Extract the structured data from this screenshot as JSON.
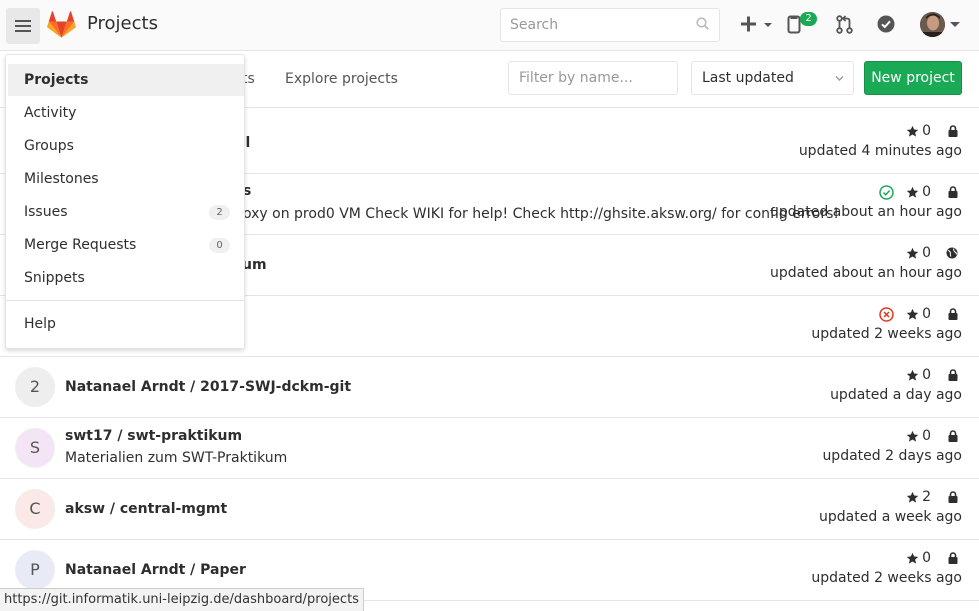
{
  "header": {
    "title": "Projects",
    "search_placeholder": "Search",
    "todo_count": "2",
    "colors": {
      "accent_green": "#1aaa55",
      "logo_orange": "#e24329"
    }
  },
  "subnav": {
    "tab_partial": "ts",
    "tab_explore": "Explore projects",
    "filter_placeholder": "Filter by name...",
    "sort_label": "Last updated",
    "new_project_label": "New project"
  },
  "rows": [
    {
      "avatar": "",
      "name": "al",
      "desc": "",
      "stars": "0",
      "updated": "updated 4 minutes ago",
      "visibility": "lock-icon",
      "status": ""
    },
    {
      "avatar": "",
      "name": "s",
      "desc": "oxy on prod0 VM Check WIKI for help! Check http://ghsite.aksw.org/ for config errors!",
      "stars": "0",
      "updated": "updated about an hour ago",
      "visibility": "lock-icon",
      "status": "success"
    },
    {
      "avatar": "",
      "name": "um",
      "desc": "",
      "stars": "0",
      "updated": "updated about an hour ago",
      "visibility": "globe-icon",
      "status": ""
    },
    {
      "avatar": "",
      "name": "",
      "desc": "",
      "stars": "0",
      "updated": "updated 2 weeks ago",
      "visibility": "lock-icon",
      "status": "failed"
    },
    {
      "avatar": "2",
      "name": "Natanael Arndt / 2017-SWJ-dckm-git",
      "desc": "",
      "stars": "0",
      "updated": "updated a day ago",
      "visibility": "lock-icon",
      "status": ""
    },
    {
      "avatar": "S",
      "name": "swt17 / swt-praktikum",
      "desc": "Materialien zum SWT-Praktikum",
      "stars": "0",
      "updated": "updated 2 days ago",
      "visibility": "lock-icon",
      "status": ""
    },
    {
      "avatar": "C",
      "name": "aksw / central-mgmt",
      "desc": "",
      "stars": "2",
      "updated": "updated a week ago",
      "visibility": "lock-icon",
      "status": ""
    },
    {
      "avatar": "P",
      "name": "Natanael Arndt / Paper",
      "desc": "",
      "stars": "0",
      "updated": "updated 2 weeks ago",
      "visibility": "lock-icon",
      "status": ""
    }
  ],
  "dropdown": {
    "items": [
      {
        "label": "Projects",
        "badge": ""
      },
      {
        "label": "Activity",
        "badge": ""
      },
      {
        "label": "Groups",
        "badge": ""
      },
      {
        "label": "Milestones",
        "badge": ""
      },
      {
        "label": "Issues",
        "badge": "2"
      },
      {
        "label": "Merge Requests",
        "badge": "0"
      },
      {
        "label": "Snippets",
        "badge": ""
      },
      {
        "label": "Help",
        "badge": ""
      }
    ]
  },
  "statusbar": {
    "url": "https://git.informatik.uni-leipzig.de/dashboard/projects"
  }
}
